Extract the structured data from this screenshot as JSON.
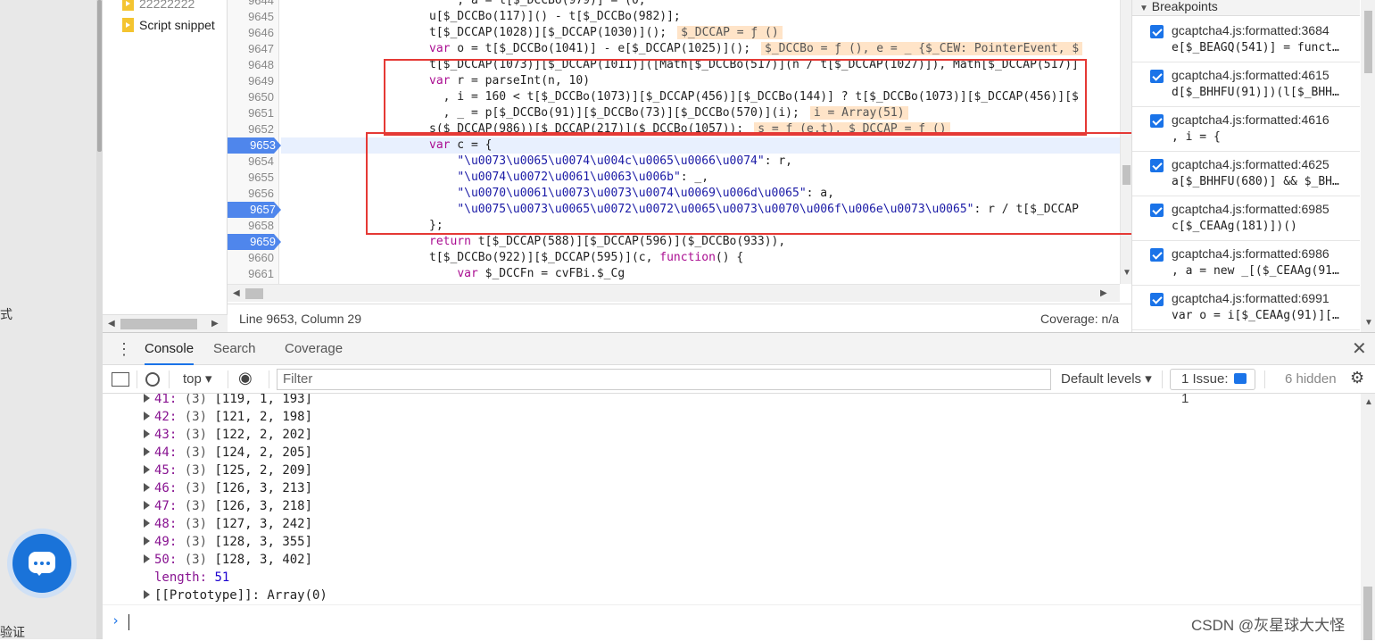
{
  "left_panel": {
    "edge_texts": [
      "式",
      "验证"
    ]
  },
  "navigator": {
    "files": [
      "22222222",
      "Script snippet"
    ]
  },
  "editor": {
    "lines": [
      {
        "no": "9644",
        "bp": false,
        "cur": false,
        "code": "    , a = t[$_DCCBo(979)] = (0,",
        "inline": ""
      },
      {
        "no": "9645",
        "bp": false,
        "cur": false,
        "code": "u[$_DCCBo(117)]() - t[$_DCCBo(982)];",
        "inline": ""
      },
      {
        "no": "9646",
        "bp": false,
        "cur": false,
        "code": "t[$_DCCAP(1028)][$_DCCAP(1030)]();",
        "inline": "$_DCCAP = ƒ ()"
      },
      {
        "no": "9647",
        "bp": false,
        "cur": false,
        "code": "var o = t[$_DCCBo(1041)] - e[$_DCCAP(1025)]();",
        "inline": "$_DCCBo = ƒ (), e = _ {$_CEW: PointerEvent, $"
      },
      {
        "no": "9648",
        "bp": false,
        "cur": false,
        "code": "t[$_DCCAP(1073)][$_DCCAP(1011)]([Math[$_DCCBo(517)](n / t[$_DCCAP(1027)]), Math[$_DCCAP(517)]",
        "inline": ""
      },
      {
        "no": "9649",
        "bp": false,
        "cur": false,
        "code": "var r = parseInt(n, 10)",
        "inline": ""
      },
      {
        "no": "9650",
        "bp": false,
        "cur": false,
        "code": "  , i = 160 < t[$_DCCBo(1073)][$_DCCAP(456)][$_DCCBo(144)] ? t[$_DCCBo(1073)][$_DCCAP(456)][$",
        "inline": ""
      },
      {
        "no": "9651",
        "bp": false,
        "cur": false,
        "code": "  , _ = p[$_DCCBo(91)][$_DCCBo(73)][$_DCCBo(570)](i);",
        "inline": "i = Array(51)"
      },
      {
        "no": "9652",
        "bp": false,
        "cur": false,
        "code": "s($_DCCAP(986))[$_DCCAP(217)]($_DCCBo(1057));",
        "inline": "s = ƒ (e,t), $_DCCAP = ƒ ()"
      },
      {
        "no": "9653",
        "bp": true,
        "cur": true,
        "code": "var c = {",
        "inline": ""
      },
      {
        "no": "9654",
        "bp": false,
        "cur": false,
        "code": "    \"\\u0073\\u0065\\u0074\\u004c\\u0065\\u0066\\u0074\": r,",
        "inline": ""
      },
      {
        "no": "9655",
        "bp": false,
        "cur": false,
        "code": "    \"\\u0074\\u0072\\u0061\\u0063\\u006b\": _,",
        "inline": ""
      },
      {
        "no": "9656",
        "bp": false,
        "cur": false,
        "code": "    \"\\u0070\\u0061\\u0073\\u0073\\u0074\\u0069\\u006d\\u0065\": a,",
        "inline": ""
      },
      {
        "no": "9657",
        "bp": true,
        "cur": false,
        "code": "    \"\\u0075\\u0073\\u0065\\u0072\\u0072\\u0065\\u0073\\u0070\\u006f\\u006e\\u0073\\u0065\": r / t[$_DCCAP",
        "inline": ""
      },
      {
        "no": "9658",
        "bp": false,
        "cur": false,
        "code": "};",
        "inline": ""
      },
      {
        "no": "9659",
        "bp": true,
        "cur": false,
        "code": "return t[$_DCCAP(588)][$_DCCAP(596)]($_DCCBo(933)),",
        "inline": ""
      },
      {
        "no": "9660",
        "bp": false,
        "cur": false,
        "code": "t[$_DCCBo(922)][$_DCCAP(595)](c, function() {",
        "inline": ""
      },
      {
        "no": "9661",
        "bp": false,
        "cur": false,
        "code": "    var $_DCCFn = cvFBi.$_Cg",
        "inline": ""
      }
    ],
    "status_position": "Line 9653, Column 29",
    "status_coverage": "Coverage: n/a"
  },
  "breakpoints": {
    "title": "Breakpoints",
    "items": [
      {
        "file": "gcaptcha4.js:formatted:3684",
        "code": "e[$_BEAGQ(541)] = funct…"
      },
      {
        "file": "gcaptcha4.js:formatted:4615",
        "code": "d[$_BHHFU(91)])(l[$_BHH…"
      },
      {
        "file": "gcaptcha4.js:formatted:4616",
        "code": ", i = {"
      },
      {
        "file": "gcaptcha4.js:formatted:4625",
        "code": "a[$_BHHFU(680)] && $_BH…"
      },
      {
        "file": "gcaptcha4.js:formatted:6985",
        "code": "c[$_CEAAg(181)])()"
      },
      {
        "file": "gcaptcha4.js:formatted:6986",
        "code": ", a = new _[($_CEAAg(91…"
      },
      {
        "file": "gcaptcha4.js:formatted:6991",
        "code": "var o = i[$_CEAAg(91)][…"
      }
    ]
  },
  "drawer": {
    "tabs": [
      "Console",
      "Search",
      "Coverage"
    ],
    "toolbar": {
      "context": "top",
      "filter_placeholder": "Filter",
      "levels": "Default levels",
      "issue_label": "1 Issue:",
      "issue_count": "1",
      "hidden": "6 hidden"
    },
    "console_rows": [
      {
        "idx": "41:",
        "len": "(3)",
        "vals": "[119, 1, 193]"
      },
      {
        "idx": "42:",
        "len": "(3)",
        "vals": "[121, 2, 198]"
      },
      {
        "idx": "43:",
        "len": "(3)",
        "vals": "[122, 2, 202]"
      },
      {
        "idx": "44:",
        "len": "(3)",
        "vals": "[124, 2, 205]"
      },
      {
        "idx": "45:",
        "len": "(3)",
        "vals": "[125, 2, 209]"
      },
      {
        "idx": "46:",
        "len": "(3)",
        "vals": "[126, 3, 213]"
      },
      {
        "idx": "47:",
        "len": "(3)",
        "vals": "[126, 3, 218]"
      },
      {
        "idx": "48:",
        "len": "(3)",
        "vals": "[127, 3, 242]"
      },
      {
        "idx": "49:",
        "len": "(3)",
        "vals": "[128, 3, 355]"
      },
      {
        "idx": "50:",
        "len": "(3)",
        "vals": "[128, 3, 402]"
      }
    ],
    "length_key": "length:",
    "length_value": "51",
    "prototype": "[[Prototype]]: Array(0)"
  },
  "watermark": "CSDN @灰星球大大怪",
  "colors": {
    "accent": "#1a73e8",
    "breakpoint": "#4f86ec",
    "highlight_box": "#e53935"
  }
}
